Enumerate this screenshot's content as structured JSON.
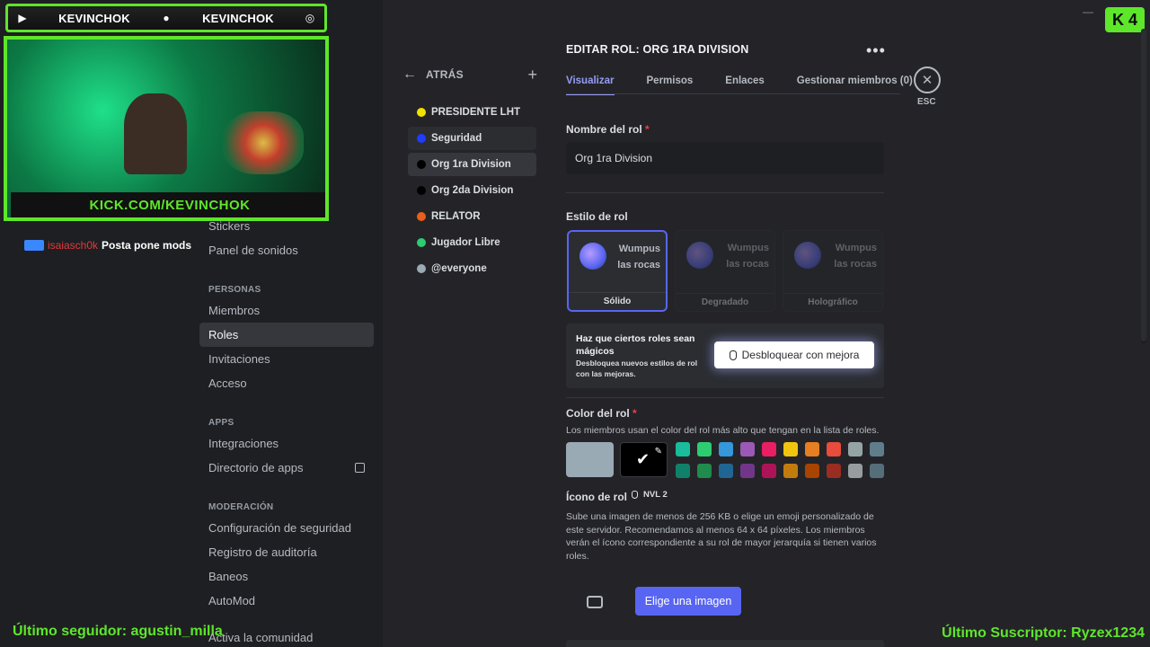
{
  "overlay": {
    "handle_left": "KEVINCHOK",
    "handle_right": "KEVINCHOK",
    "cam_label": "KICK.COM/KEVINCHOK",
    "chat_user": "isaiasch0k",
    "chat_message": "Posta pone mods",
    "last_follower": "Último seguidor: agustin_milla",
    "last_subscriber": "Último Suscriptor: Ryzex1234",
    "kick_logo": "K 4"
  },
  "nav": {
    "items_top": [
      "Stickers",
      "Panel de sonidos"
    ],
    "section_people": "PERSONAS",
    "people_items": [
      "Miembros",
      "Roles",
      "Invitaciones",
      "Acceso"
    ],
    "section_apps": "APPS",
    "apps_items": [
      "Integraciones",
      "Directorio de apps"
    ],
    "section_mod": "MODERACIÓN",
    "mod_items": [
      "Configuración de seguridad",
      "Registro de auditoría",
      "Baneos",
      "AutoMod"
    ],
    "community": "Activa la comunidad"
  },
  "roles": {
    "back_label": "ATRÁS",
    "list": [
      {
        "name": "PRESIDENTE LHT",
        "color": "#f5e100"
      },
      {
        "name": "Seguridad",
        "color": "#1f3cff"
      },
      {
        "name": "Org 1ra Division",
        "color": "#000000"
      },
      {
        "name": "Org 2da Division",
        "color": "#000000"
      },
      {
        "name": "RELATOR",
        "color": "#e8601c"
      },
      {
        "name": "Jugador Libre",
        "color": "#2ecc71"
      },
      {
        "name": "@everyone",
        "color": "#99aab5"
      }
    ]
  },
  "editor": {
    "title": "EDITAR ROL: ORG 1RA DIVISION",
    "tabs": [
      "Visualizar",
      "Permisos",
      "Enlaces",
      "Gestionar miembros (0)"
    ],
    "esc_label": "ESC",
    "role_name_label": "Nombre del rol",
    "role_name_value": "Org 1ra Division",
    "style_label": "Estilo de rol",
    "style_cards": [
      {
        "preview": "Wumpus las rocas",
        "label": "Sólido"
      },
      {
        "preview": "Wumpus las rocas",
        "label": "Degradado"
      },
      {
        "preview": "Wumpus las rocas",
        "label": "Holográfico"
      }
    ],
    "promo_title": "Haz que ciertos roles sean mágicos",
    "promo_sub": "Desbloquea nuevos estilos de rol con las mejoras.",
    "unlock_button": "Desbloquear con mejora",
    "color_label": "Color del rol",
    "color_help": "Los miembros usan el color del rol más alto que tengan en la lista de roles.",
    "swatch_row1": [
      "#1abc9c",
      "#2ecc71",
      "#3498db",
      "#9b59b6",
      "#e91e63",
      "#f1c40f",
      "#e67e22",
      "#e74c3c",
      "#95a5a6",
      "#607d8b"
    ],
    "swatch_row2": [
      "#11806a",
      "#1f8b4c",
      "#206694",
      "#71368a",
      "#ad1457",
      "#c27c0e",
      "#a84300",
      "#992d22",
      "#979c9f",
      "#546e7a"
    ],
    "icon_label": "Ícono de rol",
    "icon_level": "NVL 2",
    "icon_help": "Sube una imagen de menos de 256 KB o elige un emoji personalizado de este servidor. Recomendamos al menos 64 x 64 píxeles. Los miembros verán el ícono correspondiente a su rol de mayor jerarquía si tienen varios roles.",
    "choose_image": "Elige una imagen"
  }
}
